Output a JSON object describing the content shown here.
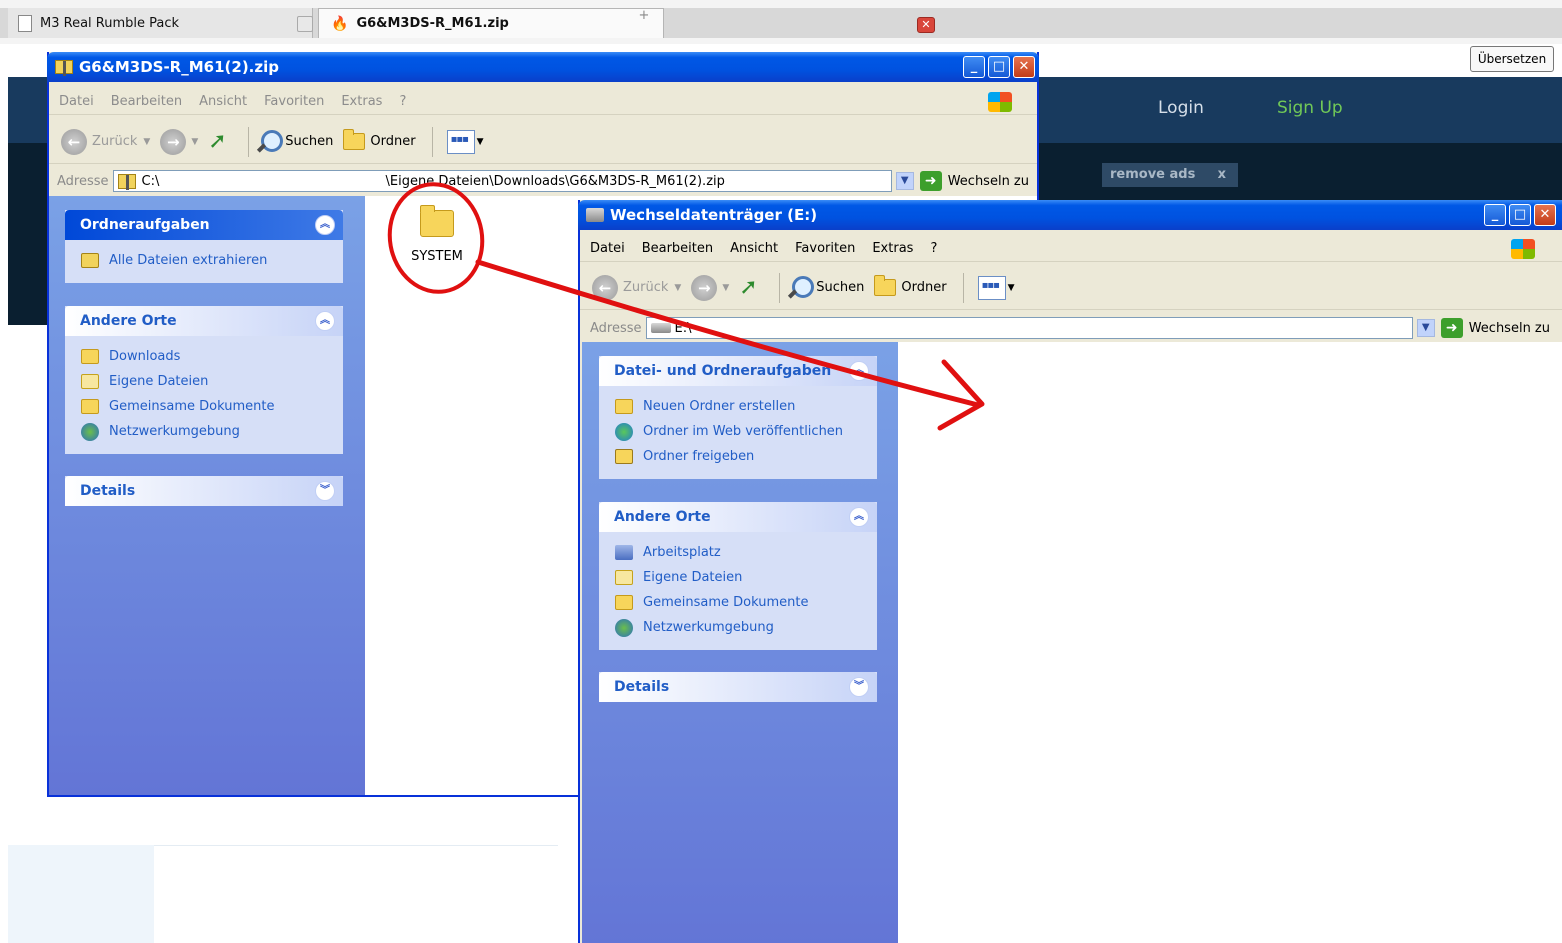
{
  "browser": {
    "tabs": [
      {
        "label": "M3 Real Rumble Pack"
      },
      {
        "label": "G6&M3DS-R_M61.zip"
      }
    ],
    "new_tab_symbol": "+",
    "translate_button": "Übersetzen"
  },
  "website": {
    "login": "Login",
    "signup": "Sign Up",
    "remove_ads": "remove ads",
    "remove_ads_close": "x"
  },
  "zip_window": {
    "title": "G6&M3DS-R_M61(2).zip",
    "menu": [
      "Datei",
      "Bearbeiten",
      "Ansicht",
      "Favoriten",
      "Extras",
      "?"
    ],
    "toolbar": {
      "back": "Zurück",
      "search": "Suchen",
      "folders": "Ordner"
    },
    "address_label": "Adresse",
    "address_start": "C:\\",
    "address_rest": "\\Eigene Dateien\\Downloads\\G6&M3DS-R_M61(2).zip",
    "go_label": "Wechseln zu",
    "panes": {
      "tasks": {
        "title": "Ordneraufgaben",
        "items": [
          "Alle Dateien extrahieren"
        ]
      },
      "places": {
        "title": "Andere Orte",
        "items": [
          "Downloads",
          "Eigene Dateien",
          "Gemeinsame Dokumente",
          "Netzwerkumgebung"
        ]
      },
      "details": {
        "title": "Details"
      }
    },
    "files": [
      {
        "name": "SYSTEM"
      }
    ]
  },
  "drive_window": {
    "title": "Wechseldatenträger (E:)",
    "menu": [
      "Datei",
      "Bearbeiten",
      "Ansicht",
      "Favoriten",
      "Extras",
      "?"
    ],
    "toolbar": {
      "back": "Zurück",
      "search": "Suchen",
      "folders": "Ordner"
    },
    "address_label": "Adresse",
    "address_value": "E:\\",
    "go_label": "Wechseln zu",
    "panes": {
      "tasks": {
        "title": "Datei- und Ordneraufgaben",
        "items": [
          "Neuen Ordner erstellen",
          "Ordner im Web veröffentlichen",
          "Ordner freigeben"
        ]
      },
      "places": {
        "title": "Andere Orte",
        "items": [
          "Arbeitsplatz",
          "Eigene Dateien",
          "Gemeinsame Dokumente",
          "Netzwerkumgebung"
        ]
      },
      "details": {
        "title": "Details"
      }
    }
  },
  "annotation": {
    "color": "#e01010"
  },
  "colors": {
    "xp_blue": "#0058e6",
    "taskpane_link": "#215dc6",
    "signup_green": "#71c957"
  }
}
